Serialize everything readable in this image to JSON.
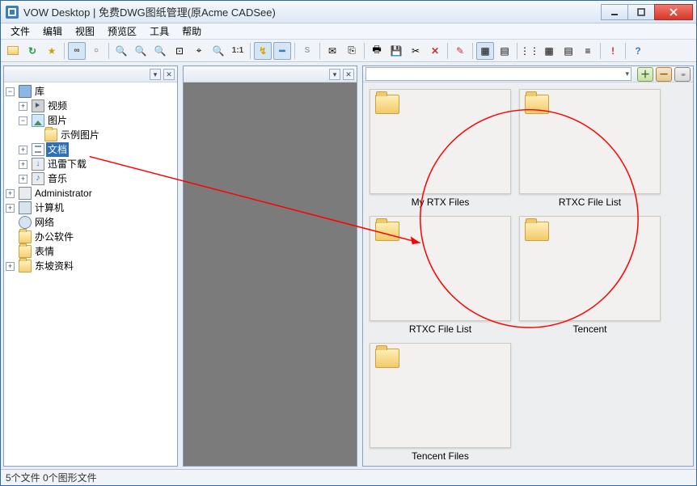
{
  "window": {
    "title": "VOW Desktop | 免费DWG图纸管理(原Acme CADSee)"
  },
  "menu": {
    "items": [
      "文件",
      "编辑",
      "视图",
      "预览区",
      "工具",
      "帮助"
    ]
  },
  "toolbar": {
    "open": "open-file-icon",
    "refresh": "refresh-icon",
    "favorite": "favorite-icon",
    "pair": "∞",
    "oval": "○",
    "zoomin": "🔍+",
    "zoomout": "🔍-",
    "zoomreset": "🔍✕",
    "zoomfit": "⌖",
    "zoomwin": "⊡",
    "zoomactual": "🔍",
    "zoom11": "1:1",
    "measure": "↗",
    "ruler": "━",
    "select": "S",
    "mail": "✉",
    "copy": "⎘",
    "print": "⎙",
    "save": "💾",
    "cut": "✂",
    "close": "✕",
    "properties": "✎!",
    "layers1": "▦",
    "layers2": "▤",
    "gridA": "⋮⋮",
    "gridB": "▦",
    "gridC": "▤",
    "gridD": "≡",
    "alert": "!",
    "help": "?"
  },
  "tree": {
    "root": {
      "label": "库"
    },
    "video": {
      "label": "视频"
    },
    "pictures": {
      "label": "图片"
    },
    "samplePics": {
      "label": "示例图片"
    },
    "documents": {
      "label": "文档"
    },
    "xunlei": {
      "label": "迅雷下载"
    },
    "music": {
      "label": "音乐"
    },
    "admin": {
      "label": "Administrator"
    },
    "computer": {
      "label": "计算机"
    },
    "network": {
      "label": "网络"
    },
    "office": {
      "label": "办公软件"
    },
    "emo": {
      "label": "表情"
    },
    "dongpo": {
      "label": "东坡资料"
    }
  },
  "thumbs": [
    {
      "name": "My RTX Files"
    },
    {
      "name": "RTXC File List"
    },
    {
      "name": "RTXC File List"
    },
    {
      "name": "Tencent"
    },
    {
      "name": "Tencent Files"
    }
  ],
  "status": {
    "text": "5个文件 0个图形文件"
  }
}
